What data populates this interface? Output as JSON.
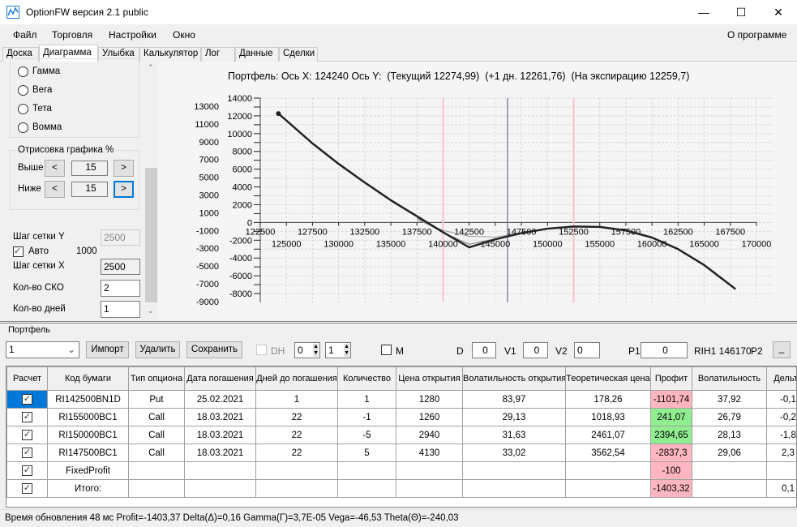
{
  "window": {
    "title": "OptionFW версия 2.1 public",
    "minimize": "—",
    "maximize": "☐",
    "close": "✕"
  },
  "menu": {
    "items": [
      "Файл",
      "Торговля",
      "Настройки",
      "Окно"
    ],
    "about": "О программе"
  },
  "tabs": [
    "Доска",
    "Диаграмма",
    "Улыбка",
    "Калькулятор",
    "Лог",
    "Данные",
    "Сделки"
  ],
  "left": {
    "radios": [
      "Гамма",
      "Вега",
      "Тета",
      "Вомма"
    ],
    "draw_group": "Отрисовка графика %",
    "above_label": "Выше",
    "above_value": "15",
    "below_label": "Ниже",
    "below_value": "15",
    "prev": "<",
    "next": ">",
    "grid_y_label": "Шаг сетки Y",
    "grid_y_value": "2500",
    "auto_label": "Авто",
    "auto_checked": true,
    "auto_value": "1000",
    "grid_x_label": "Шаг сетки X",
    "grid_x_value": "2500",
    "sko_label": "Кол-во СКО",
    "sko_value": "2",
    "days_label": "Кол-во дней",
    "days_value": "1"
  },
  "chart_data": {
    "type": "line",
    "title": "Портфель: Ось X: 124240 Ось Y:  (Текущий 12274,99)  (+1 дн. 12261,76)  (На экспирацию 12259,7)",
    "xlim": [
      122500,
      170000
    ],
    "ylim": [
      -9000,
      14000
    ],
    "grid": true,
    "x_ticks_top": [
      "122500",
      "127500",
      "132500",
      "137500",
      "142500",
      "147500",
      "152500",
      "157500",
      "162500",
      "167500"
    ],
    "x_ticks_bottom": [
      "125000",
      "130000",
      "135000",
      "140000",
      "145000",
      "150000",
      "155000",
      "160000",
      "165000",
      "170000"
    ],
    "y_ticks_inner": [
      "14000",
      "12000",
      "10000",
      "8000",
      "6000",
      "4000",
      "2000",
      "0",
      "-2000",
      "-4000",
      "-6000",
      "-8000"
    ],
    "y_ticks_outer": [
      "13000",
      "11000",
      "9000",
      "7000",
      "5000",
      "3000",
      "1000",
      "-1000",
      "-3000",
      "-5000",
      "-7000",
      "-9000"
    ],
    "vlines": [
      {
        "x": 140000,
        "color": "#ffc0cb"
      },
      {
        "x": 152500,
        "color": "#ffc0cb"
      },
      {
        "x": 146170,
        "color": "#4a5a7a"
      }
    ],
    "series": [
      {
        "color": "#222222",
        "width": 2.5,
        "points": [
          [
            124240,
            12260
          ],
          [
            127500,
            8900
          ],
          [
            130000,
            6600
          ],
          [
            132500,
            4500
          ],
          [
            135000,
            2500
          ],
          [
            137500,
            700
          ],
          [
            140000,
            -1100
          ],
          [
            142500,
            -2800
          ],
          [
            145000,
            -1900
          ],
          [
            147500,
            -1200
          ],
          [
            150000,
            -700
          ],
          [
            152500,
            -450
          ],
          [
            155000,
            -500
          ],
          [
            157500,
            -900
          ],
          [
            160000,
            -1700
          ],
          [
            162500,
            -3000
          ],
          [
            165000,
            -4800
          ],
          [
            168000,
            -7500
          ]
        ]
      },
      {
        "color": "#999999",
        "width": 1,
        "points": [
          [
            137500,
            300
          ],
          [
            140000,
            -900
          ],
          [
            142500,
            -1550
          ],
          [
            145000,
            -1650
          ],
          [
            147500,
            -1200
          ]
        ]
      },
      {
        "color": "#777777",
        "width": 1,
        "points": [
          [
            137500,
            500
          ],
          [
            140000,
            -1150
          ],
          [
            142500,
            -2450
          ],
          [
            145000,
            -1850
          ]
        ]
      }
    ]
  },
  "portfolio": {
    "group": "Портфель",
    "combo_value": "1",
    "import": "Импорт",
    "delete": "Удалить",
    "save": "Сохранить",
    "dh_label": "DH",
    "spin1": "0",
    "spin2": "1",
    "m_label": "M",
    "d_label": "D",
    "d_value": "0",
    "v1_label": "V1",
    "v1_value": "0",
    "v2_label": "V2",
    "v2_value": "0",
    "p1_label": "P1",
    "p1_value": "0",
    "instrument": "RIH1 146170",
    "p2_label": "P2",
    "p2_btn": "_",
    "columns": [
      "Расчет",
      "Код бумаги",
      "Тип опциона",
      "Дата погашения",
      "Дней до погашения",
      "Количество",
      "Цена открытия",
      "Волатильность открытия",
      "Теоретическая цена",
      "Профит",
      "Волатильность",
      "Дельта"
    ],
    "rows": [
      {
        "check": "✓",
        "code": "RI142500BN1D",
        "type": "Put",
        "date": "25.02.2021",
        "days": "1",
        "qty": "1",
        "price": "1280",
        "vol_open": "83,97",
        "theor": "178,26",
        "profit": "-1101,74",
        "profit_color": "red",
        "vol": "37,92",
        "delta": "-0,1"
      },
      {
        "check": "✓",
        "code": "RI155000BC1",
        "type": "Call",
        "date": "18.03.2021",
        "days": "22",
        "qty": "-1",
        "price": "1260",
        "vol_open": "29,13",
        "theor": "1018,93",
        "profit": "241,07",
        "profit_color": "green",
        "vol": "26,79",
        "delta": "-0,2"
      },
      {
        "check": "✓",
        "code": "RI150000BC1",
        "type": "Call",
        "date": "18.03.2021",
        "days": "22",
        "qty": "-5",
        "price": "2940",
        "vol_open": "31,63",
        "theor": "2461,07",
        "profit": "2394,65",
        "profit_color": "green",
        "vol": "28,13",
        "delta": "-1,8"
      },
      {
        "check": "✓",
        "code": "RI147500BC1",
        "type": "Call",
        "date": "18.03.2021",
        "days": "22",
        "qty": "5",
        "price": "4130",
        "vol_open": "33,02",
        "theor": "3562,54",
        "profit": "-2837,3",
        "profit_color": "red",
        "vol": "29,06",
        "delta": "2,3"
      },
      {
        "check": "✓",
        "code": "FixedProfit",
        "type": "",
        "date": "",
        "days": "",
        "qty": "",
        "price": "",
        "vol_open": "",
        "theor": "",
        "profit": "-100",
        "profit_color": "red",
        "vol": "",
        "delta": ""
      },
      {
        "check": "✓",
        "code": "Итого:",
        "type": "",
        "date": "",
        "days": "",
        "qty": "",
        "price": "",
        "vol_open": "",
        "theor": "",
        "profit": "-1403,32",
        "profit_color": "red",
        "vol": "",
        "delta": "0,1"
      }
    ]
  },
  "status": "Время обновления 48 мс  Profit=-1403,37 Delta(Δ)=0,16 Gamma(Γ)=3,7E-05 Vega=-46,53 Theta(Θ)=-240,03"
}
